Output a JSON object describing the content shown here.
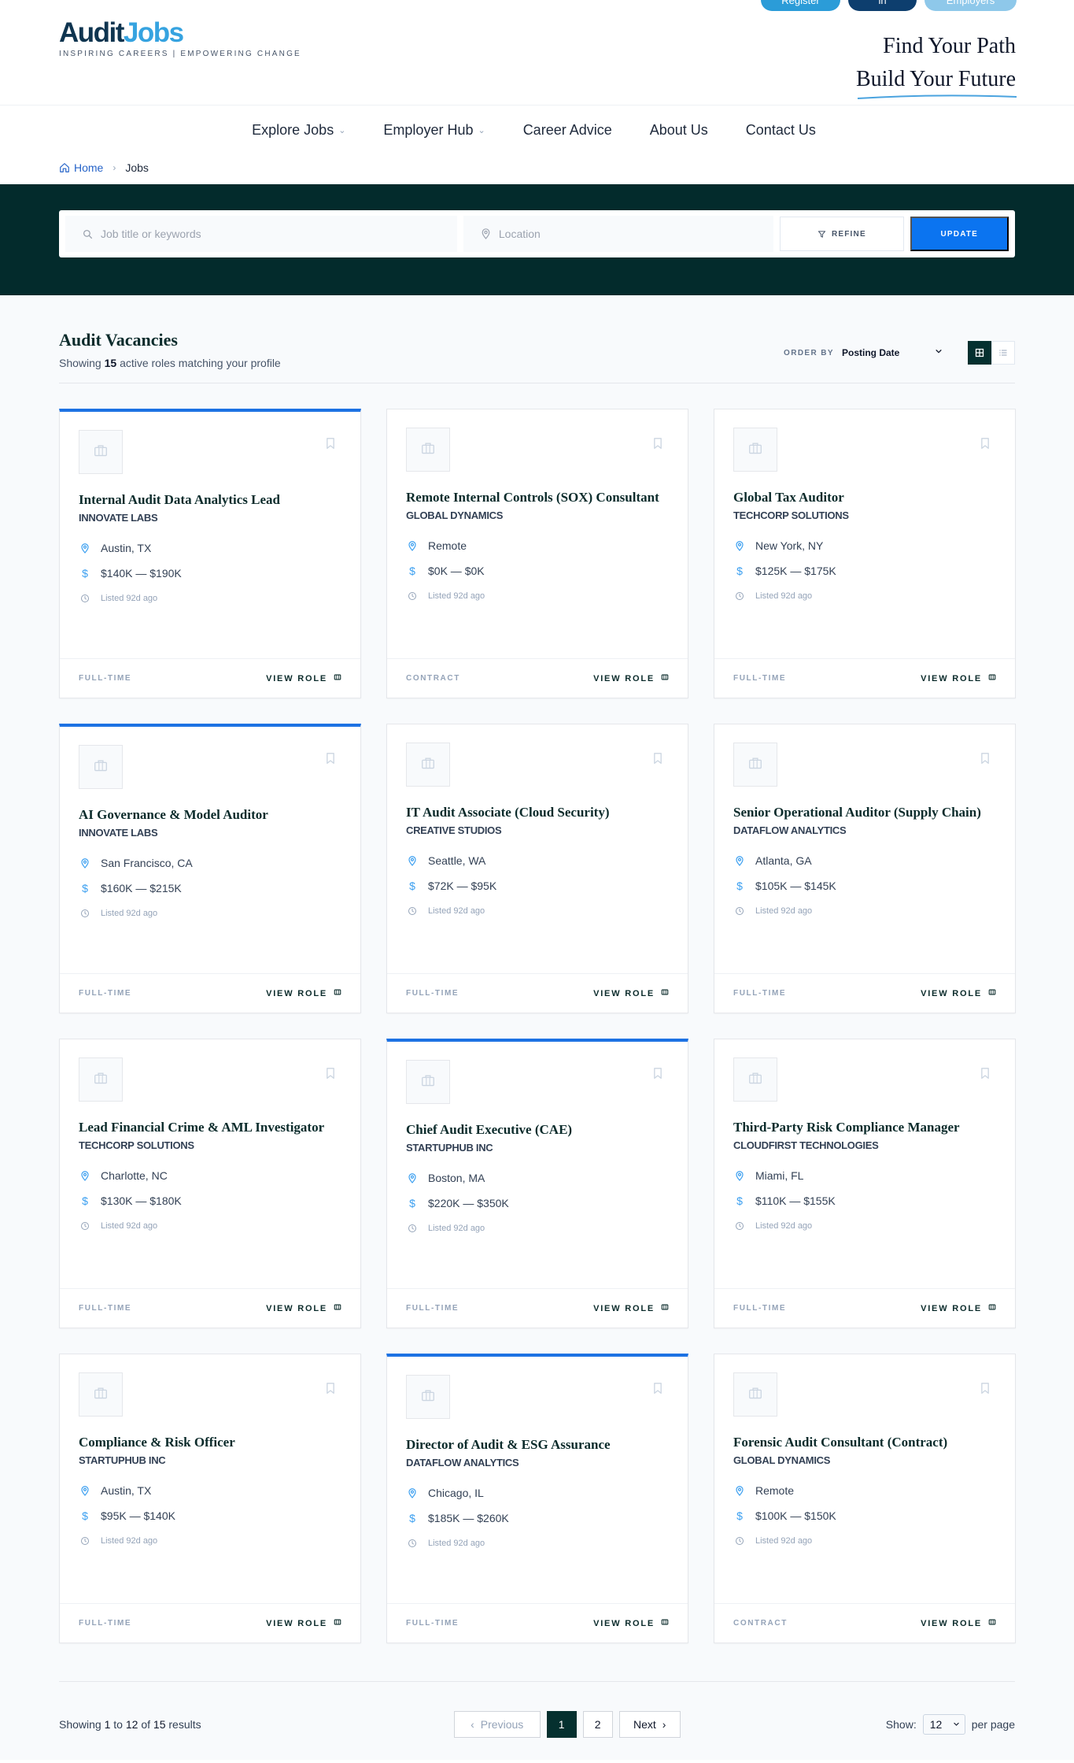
{
  "header": {
    "buttons": {
      "register": "Register",
      "login": "Log in",
      "employers": "Employers"
    },
    "logo": {
      "part1": "Audit",
      "part2": "Jobs",
      "tagline": "INSPIRING CAREERS | EMPOWERING CHANGE"
    },
    "slogan": {
      "line1": "Find Your Path",
      "line2": "Build Your Future"
    }
  },
  "nav": {
    "items": [
      {
        "label": "Explore Jobs",
        "has_dropdown": true
      },
      {
        "label": "Employer Hub",
        "has_dropdown": true
      },
      {
        "label": "Career Advice",
        "has_dropdown": false
      },
      {
        "label": "About Us",
        "has_dropdown": false
      },
      {
        "label": "Contact Us",
        "has_dropdown": false
      }
    ]
  },
  "breadcrumb": {
    "home": "Home",
    "current": "Jobs"
  },
  "search": {
    "keyword_placeholder": "Job title or keywords",
    "location_placeholder": "Location",
    "refine_label": "REFINE",
    "update_label": "UPDATE"
  },
  "listing": {
    "title": "Audit Vacancies",
    "showing_prefix": "Showing",
    "count": "15",
    "showing_suffix": "active roles matching your profile",
    "order_label": "ORDER BY",
    "order_value": "Posting Date"
  },
  "jobs": [
    {
      "title": "Internal Audit Data Analytics Lead",
      "company": "INNOVATE LABS",
      "location": "Austin, TX",
      "salary": "$140K — $190K",
      "posted": "Listed 92d ago",
      "type": "FULL-TIME",
      "featured": true
    },
    {
      "title": "Remote Internal Controls (SOX) Consultant",
      "company": "GLOBAL DYNAMICS",
      "location": "Remote",
      "salary": "$0K — $0K",
      "posted": "Listed 92d ago",
      "type": "CONTRACT",
      "featured": false
    },
    {
      "title": "Global Tax Auditor",
      "company": "TECHCORP SOLUTIONS",
      "location": "New York, NY",
      "salary": "$125K — $175K",
      "posted": "Listed 92d ago",
      "type": "FULL-TIME",
      "featured": false
    },
    {
      "title": "AI Governance & Model Auditor",
      "company": "INNOVATE LABS",
      "location": "San Francisco, CA",
      "salary": "$160K — $215K",
      "posted": "Listed 92d ago",
      "type": "FULL-TIME",
      "featured": true
    },
    {
      "title": "IT Audit Associate (Cloud Security)",
      "company": "CREATIVE STUDIOS",
      "location": "Seattle, WA",
      "salary": "$72K — $95K",
      "posted": "Listed 92d ago",
      "type": "FULL-TIME",
      "featured": false
    },
    {
      "title": "Senior Operational Auditor (Supply Chain)",
      "company": "DATAFLOW ANALYTICS",
      "location": "Atlanta, GA",
      "salary": "$105K — $145K",
      "posted": "Listed 92d ago",
      "type": "FULL-TIME",
      "featured": false
    },
    {
      "title": "Lead Financial Crime & AML Investigator",
      "company": "TECHCORP SOLUTIONS",
      "location": "Charlotte, NC",
      "salary": "$130K — $180K",
      "posted": "Listed 92d ago",
      "type": "FULL-TIME",
      "featured": false
    },
    {
      "title": "Chief Audit Executive (CAE)",
      "company": "STARTUPHUB INC",
      "location": "Boston, MA",
      "salary": "$220K — $350K",
      "posted": "Listed 92d ago",
      "type": "FULL-TIME",
      "featured": true
    },
    {
      "title": "Third-Party Risk Compliance Manager",
      "company": "CLOUDFIRST TECHNOLOGIES",
      "location": "Miami, FL",
      "salary": "$110K — $155K",
      "posted": "Listed 92d ago",
      "type": "FULL-TIME",
      "featured": false
    },
    {
      "title": "Compliance & Risk Officer",
      "company": "STARTUPHUB INC",
      "location": "Austin, TX",
      "salary": "$95K — $140K",
      "posted": "Listed 92d ago",
      "type": "FULL-TIME",
      "featured": false
    },
    {
      "title": "Director of Audit & ESG Assurance",
      "company": "DATAFLOW ANALYTICS",
      "location": "Chicago, IL",
      "salary": "$185K — $260K",
      "posted": "Listed 92d ago",
      "type": "FULL-TIME",
      "featured": true
    },
    {
      "title": "Forensic Audit Consultant (Contract)",
      "company": "GLOBAL DYNAMICS",
      "location": "Remote",
      "salary": "$100K — $150K",
      "posted": "Listed 92d ago",
      "type": "CONTRACT",
      "featured": false
    }
  ],
  "card_action": "VIEW ROLE",
  "pagination": {
    "info_prefix": "Showing",
    "from": "1",
    "to_word": "to",
    "to": "12",
    "of_word": "of",
    "total": "15",
    "results_word": "results",
    "prev": "Previous",
    "pages": [
      "1",
      "2"
    ],
    "current": "1",
    "next": "Next",
    "show_label": "Show:",
    "per_page_value": "12",
    "per_page_label": "per page"
  },
  "colors": {
    "accent_blue": "#0b74f0",
    "dark_teal": "#032b2c",
    "logo_navy": "#0f3550",
    "logo_sky": "#36a3e0"
  }
}
